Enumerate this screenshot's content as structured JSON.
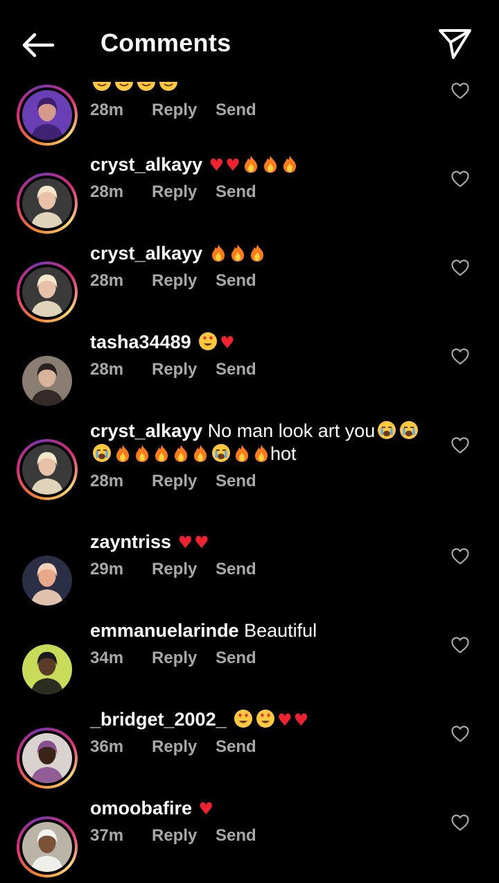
{
  "header": {
    "title": "Comments"
  },
  "comments": [
    {
      "username": "",
      "text": "",
      "emojis": [
        "face",
        "face",
        "face",
        "face"
      ],
      "time": "28m",
      "reply": "Reply",
      "send": "Send",
      "avatar_ring": true,
      "avatar_icon": "avatar-purple-cartoon"
    },
    {
      "username": "cryst_alkayy",
      "text": "",
      "emojis": [
        "heart",
        "heart",
        "fire",
        "fire",
        "fire"
      ],
      "time": "28m",
      "reply": "Reply",
      "send": "Send",
      "avatar_ring": true,
      "avatar_icon": "avatar-woman-blonde"
    },
    {
      "username": "cryst_alkayy",
      "text": "",
      "emojis": [
        "fire",
        "fire",
        "fire"
      ],
      "time": "28m",
      "reply": "Reply",
      "send": "Send",
      "avatar_ring": true,
      "avatar_icon": "avatar-woman-blonde"
    },
    {
      "username": "tasha34489",
      "text": "",
      "emojis": [
        "heart-eyes",
        "heart"
      ],
      "time": "28m",
      "reply": "Reply",
      "send": "Send",
      "avatar_ring": false,
      "avatar_icon": "avatar-woman-dark-hair"
    },
    {
      "username": "cryst_alkayy",
      "text": "No man look art you",
      "emojis": [
        "crying",
        "crying"
      ],
      "text_line2_emojis": [
        "crying",
        "fire",
        "fire",
        "fire",
        "fire",
        "fire",
        "crying",
        "fire",
        "fire"
      ],
      "text_line2": "hot",
      "time": "28m",
      "reply": "Reply",
      "send": "Send",
      "avatar_ring": true,
      "avatar_icon": "avatar-woman-blonde"
    },
    {
      "username": "zayntriss",
      "text": "",
      "emojis": [
        "heart",
        "heart"
      ],
      "time": "29m",
      "reply": "Reply",
      "send": "Send",
      "avatar_ring": false,
      "avatar_icon": "avatar-man-standing"
    },
    {
      "username": "emmanuelarinde",
      "text": "Beautiful",
      "emojis": [],
      "time": "34m",
      "reply": "Reply",
      "send": "Send",
      "avatar_ring": false,
      "avatar_icon": "avatar-man-sunglasses"
    },
    {
      "username": "_bridget_2002_",
      "text": "",
      "emojis": [
        "heart-eyes",
        "heart-eyes",
        "heart",
        "heart"
      ],
      "time": "36m",
      "reply": "Reply",
      "send": "Send",
      "avatar_ring": true,
      "avatar_icon": "avatar-woman-headwrap"
    },
    {
      "username": "omoobafire",
      "text": "",
      "emojis": [
        "heart"
      ],
      "time": "37m",
      "reply": "Reply",
      "send": "Send",
      "avatar_ring": true,
      "avatar_icon": "avatar-man-white-shirt"
    }
  ],
  "colors": {
    "background": "#000000",
    "text": "#ffffff",
    "secondary_text": "#a8a8a8",
    "heart": "#f0222f",
    "fire": "#ff7a1a",
    "face": "#ffc83d"
  }
}
